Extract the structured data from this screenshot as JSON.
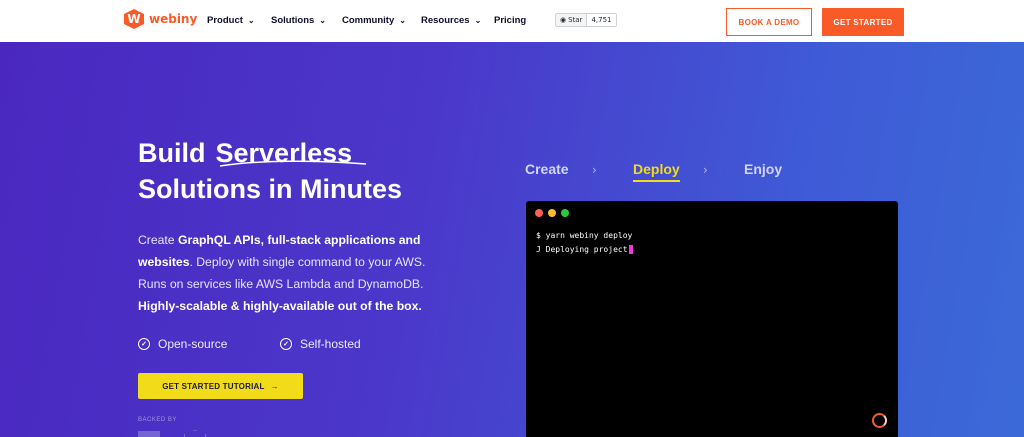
{
  "brand": {
    "name": "webiny",
    "logo_letter": "W",
    "color": "#fa5a28"
  },
  "nav": {
    "items": [
      {
        "label": "Product",
        "has_dropdown": true
      },
      {
        "label": "Solutions",
        "has_dropdown": true
      },
      {
        "label": "Community",
        "has_dropdown": true
      },
      {
        "label": "Resources",
        "has_dropdown": true
      },
      {
        "label": "Pricing",
        "has_dropdown": false
      }
    ],
    "github": {
      "star_label": "Star",
      "count": "4,751"
    },
    "book_demo": "BOOK A DEMO",
    "get_started": "GET STARTED"
  },
  "hero": {
    "headline_1a": "Build",
    "headline_1b": "Serverless",
    "headline_2": "Solutions in Minutes",
    "desc": {
      "p1": "Create ",
      "b1": "GraphQL APIs, full-stack applications and websites",
      "p2": ". Deploy with single command to your AWS. Runs on services like AWS Lambda and DynamoDB. ",
      "b2": "Highly-scalable & highly-available out of the box."
    },
    "features": [
      "Open-source",
      "Self-hosted"
    ],
    "cta": "GET STARTED TUTORIAL",
    "cta_arrow": "→",
    "backed_by": "BACKED BY"
  },
  "steps": {
    "items": [
      "Create",
      "Deploy",
      "Enjoy"
    ],
    "active": "Deploy",
    "separator": "›"
  },
  "terminal": {
    "line1": "$ yarn webiny deploy",
    "line2": "J Deploying project",
    "dots": [
      "#ff5f56",
      "#ffbd2e",
      "#27c93f"
    ]
  },
  "colors": {
    "accent_orange": "#fa5a28",
    "accent_yellow": "#f2dc1a",
    "hero_gradient_start": "#4a28c0",
    "hero_gradient_end": "#3b6ad8"
  }
}
